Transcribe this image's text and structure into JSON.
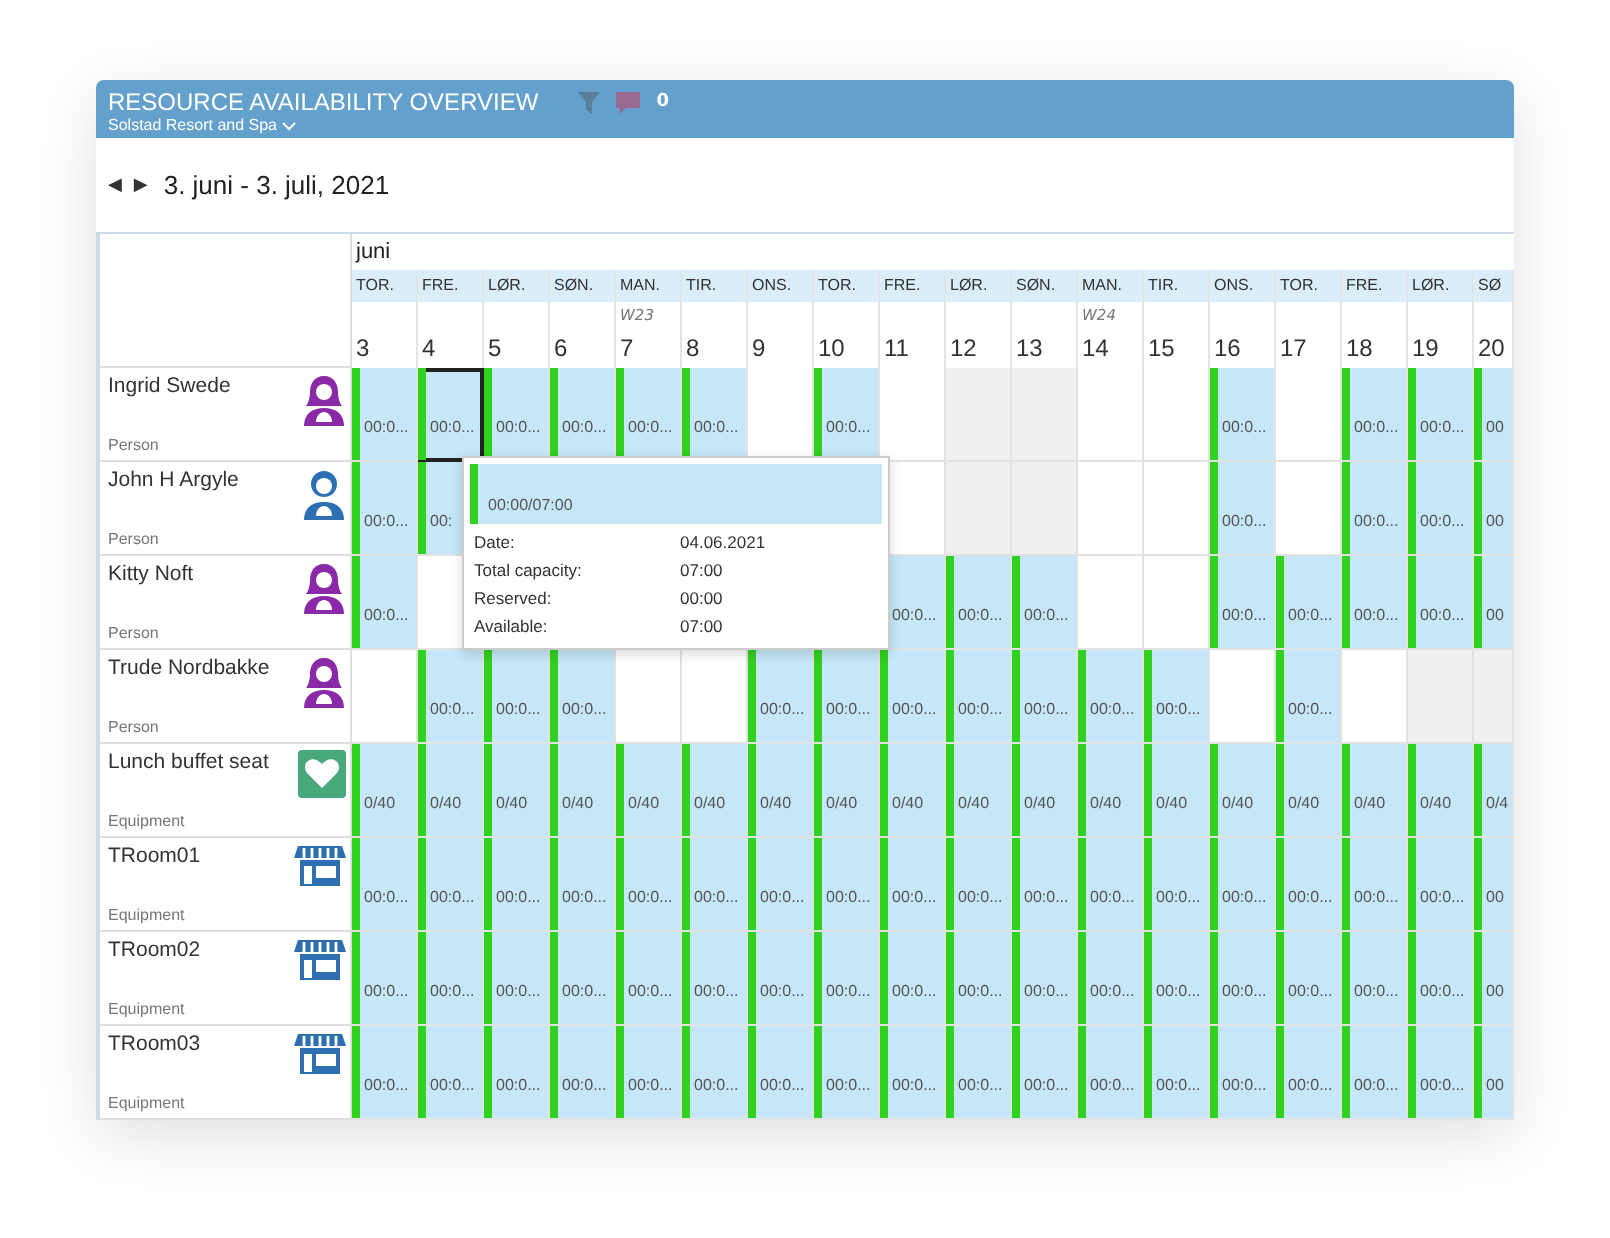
{
  "header": {
    "title": "RESOURCE AVAILABILITY OVERVIEW",
    "comment_count": "0",
    "subtitle": "Solstad Resort and Spa"
  },
  "nav": {
    "prev": "◀",
    "next": "▶",
    "range": "3. juni - 3. juli, 2021"
  },
  "month": "juni",
  "columns": [
    {
      "day_name": "TOR.",
      "day": "3"
    },
    {
      "day_name": "FRE.",
      "day": "4"
    },
    {
      "day_name": "LØR.",
      "day": "5"
    },
    {
      "day_name": "SØN.",
      "day": "6"
    },
    {
      "day_name": "MAN.",
      "day": "7",
      "week": "W23"
    },
    {
      "day_name": "TIR.",
      "day": "8"
    },
    {
      "day_name": "ONS.",
      "day": "9"
    },
    {
      "day_name": "TOR.",
      "day": "10"
    },
    {
      "day_name": "FRE.",
      "day": "11"
    },
    {
      "day_name": "LØR.",
      "day": "12"
    },
    {
      "day_name": "SØN.",
      "day": "13"
    },
    {
      "day_name": "MAN.",
      "day": "14",
      "week": "W24"
    },
    {
      "day_name": "TIR.",
      "day": "15"
    },
    {
      "day_name": "ONS.",
      "day": "16"
    },
    {
      "day_name": "TOR.",
      "day": "17"
    },
    {
      "day_name": "FRE.",
      "day": "18"
    },
    {
      "day_name": "LØR.",
      "day": "19"
    },
    {
      "day_name": "SØ",
      "day": "20"
    }
  ],
  "resources": [
    {
      "name": "Ingrid Swede",
      "type": "Person",
      "kind": "woman",
      "cells": [
        {
          "kind": "booked",
          "text": "00:0...",
          "selected": false
        },
        {
          "kind": "booked",
          "text": "00:0...",
          "selected": true
        },
        {
          "kind": "booked",
          "text": "00:0...",
          "selected": false
        },
        {
          "kind": "booked",
          "text": "00:0...",
          "selected": false
        },
        {
          "kind": "booked",
          "text": "00:0...",
          "selected": false
        },
        {
          "kind": "booked",
          "text": "00:0...",
          "selected": false
        },
        {
          "kind": "free",
          "selected": false
        },
        {
          "kind": "booked",
          "text": "00:0...",
          "selected": false
        },
        {
          "kind": "free",
          "selected": false
        },
        {
          "kind": "closed",
          "selected": false
        },
        {
          "kind": "closed",
          "selected": false
        },
        {
          "kind": "free",
          "selected": false
        },
        {
          "kind": "free",
          "selected": false
        },
        {
          "kind": "booked",
          "text": "00:0...",
          "selected": false
        },
        {
          "kind": "free",
          "selected": false
        },
        {
          "kind": "booked",
          "text": "00:0...",
          "selected": false
        },
        {
          "kind": "booked",
          "text": "00:0...",
          "selected": false
        },
        {
          "kind": "booked",
          "text": "00",
          "selected": false
        }
      ]
    },
    {
      "name": "John H Argyle",
      "type": "Person",
      "kind": "man",
      "cells": [
        {
          "kind": "booked",
          "text": "00:0...",
          "selected": false
        },
        {
          "kind": "booked",
          "text": "00:",
          "selected": false
        },
        {
          "kind": "covered"
        },
        {
          "kind": "covered"
        },
        {
          "kind": "covered"
        },
        {
          "kind": "covered"
        },
        {
          "kind": "covered"
        },
        {
          "kind": "covered"
        },
        {
          "kind": "free",
          "selected": false
        },
        {
          "kind": "closed",
          "selected": false
        },
        {
          "kind": "closed",
          "selected": false
        },
        {
          "kind": "free",
          "selected": false
        },
        {
          "kind": "free",
          "selected": false
        },
        {
          "kind": "booked",
          "text": "00:0...",
          "selected": false
        },
        {
          "kind": "free",
          "selected": false
        },
        {
          "kind": "booked",
          "text": "00:0...",
          "selected": false
        },
        {
          "kind": "booked",
          "text": "00:0...",
          "selected": false
        },
        {
          "kind": "booked",
          "text": "00",
          "selected": false
        }
      ]
    },
    {
      "name": "Kitty Noft",
      "type": "Person",
      "kind": "woman",
      "cells": [
        {
          "kind": "booked",
          "text": "00:0...",
          "selected": false
        },
        {
          "kind": "free",
          "selected": false
        },
        {
          "kind": "covered"
        },
        {
          "kind": "covered"
        },
        {
          "kind": "covered"
        },
        {
          "kind": "covered"
        },
        {
          "kind": "covered"
        },
        {
          "kind": "covered"
        },
        {
          "kind": "booked",
          "text": "00:0...",
          "selected": false
        },
        {
          "kind": "booked",
          "text": "00:0...",
          "selected": false
        },
        {
          "kind": "booked",
          "text": "00:0...",
          "selected": false
        },
        {
          "kind": "free",
          "selected": false
        },
        {
          "kind": "free",
          "selected": false
        },
        {
          "kind": "booked",
          "text": "00:0...",
          "selected": false
        },
        {
          "kind": "booked",
          "text": "00:0...",
          "selected": false
        },
        {
          "kind": "booked",
          "text": "00:0...",
          "selected": false
        },
        {
          "kind": "booked",
          "text": "00:0...",
          "selected": false
        },
        {
          "kind": "booked",
          "text": "00",
          "selected": false
        }
      ]
    },
    {
      "name": "Trude Nordbakke",
      "type": "Person",
      "kind": "woman",
      "cells": [
        {
          "kind": "free",
          "selected": false
        },
        {
          "kind": "booked",
          "text": "00:0...",
          "selected": false
        },
        {
          "kind": "booked",
          "text": "00:0...",
          "selected": false
        },
        {
          "kind": "booked",
          "text": "00:0...",
          "selected": false
        },
        {
          "kind": "free",
          "selected": false
        },
        {
          "kind": "free",
          "selected": false
        },
        {
          "kind": "booked",
          "text": "00:0...",
          "selected": false
        },
        {
          "kind": "booked",
          "text": "00:0...",
          "selected": false
        },
        {
          "kind": "booked",
          "text": "00:0...",
          "selected": false
        },
        {
          "kind": "booked",
          "text": "00:0...",
          "selected": false
        },
        {
          "kind": "booked",
          "text": "00:0...",
          "selected": false
        },
        {
          "kind": "booked",
          "text": "00:0...",
          "selected": false
        },
        {
          "kind": "booked",
          "text": "00:0...",
          "selected": false
        },
        {
          "kind": "free",
          "selected": false
        },
        {
          "kind": "booked",
          "text": "00:0...",
          "selected": false
        },
        {
          "kind": "free",
          "selected": false
        },
        {
          "kind": "closed",
          "selected": false
        },
        {
          "kind": "closed",
          "selected": false
        }
      ]
    },
    {
      "name": "Lunch buffet seat",
      "type": "Equipment",
      "kind": "heart",
      "cells": [
        {
          "kind": "booked",
          "text": "0/40",
          "selected": false
        },
        {
          "kind": "booked",
          "text": "0/40",
          "selected": false
        },
        {
          "kind": "booked",
          "text": "0/40",
          "selected": false
        },
        {
          "kind": "booked",
          "text": "0/40",
          "selected": false
        },
        {
          "kind": "booked",
          "text": "0/40",
          "selected": false
        },
        {
          "kind": "booked",
          "text": "0/40",
          "selected": false
        },
        {
          "kind": "booked",
          "text": "0/40",
          "selected": false
        },
        {
          "kind": "booked",
          "text": "0/40",
          "selected": false
        },
        {
          "kind": "booked",
          "text": "0/40",
          "selected": false
        },
        {
          "kind": "booked",
          "text": "0/40",
          "selected": false
        },
        {
          "kind": "booked",
          "text": "0/40",
          "selected": false
        },
        {
          "kind": "booked",
          "text": "0/40",
          "selected": false
        },
        {
          "kind": "booked",
          "text": "0/40",
          "selected": false
        },
        {
          "kind": "booked",
          "text": "0/40",
          "selected": false
        },
        {
          "kind": "booked",
          "text": "0/40",
          "selected": false
        },
        {
          "kind": "booked",
          "text": "0/40",
          "selected": false
        },
        {
          "kind": "booked",
          "text": "0/40",
          "selected": false
        },
        {
          "kind": "booked",
          "text": "0/4",
          "selected": false
        }
      ]
    },
    {
      "name": "TRoom01",
      "type": "Equipment",
      "kind": "store",
      "cells": [
        {
          "kind": "booked",
          "text": "00:0...",
          "selected": false
        },
        {
          "kind": "booked",
          "text": "00:0...",
          "selected": false
        },
        {
          "kind": "booked",
          "text": "00:0...",
          "selected": false
        },
        {
          "kind": "booked",
          "text": "00:0...",
          "selected": false
        },
        {
          "kind": "booked",
          "text": "00:0...",
          "selected": false
        },
        {
          "kind": "booked",
          "text": "00:0...",
          "selected": false
        },
        {
          "kind": "booked",
          "text": "00:0...",
          "selected": false
        },
        {
          "kind": "booked",
          "text": "00:0...",
          "selected": false
        },
        {
          "kind": "booked",
          "text": "00:0...",
          "selected": false
        },
        {
          "kind": "booked",
          "text": "00:0...",
          "selected": false
        },
        {
          "kind": "booked",
          "text": "00:0...",
          "selected": false
        },
        {
          "kind": "booked",
          "text": "00:0...",
          "selected": false
        },
        {
          "kind": "booked",
          "text": "00:0...",
          "selected": false
        },
        {
          "kind": "booked",
          "text": "00:0...",
          "selected": false
        },
        {
          "kind": "booked",
          "text": "00:0...",
          "selected": false
        },
        {
          "kind": "booked",
          "text": "00:0...",
          "selected": false
        },
        {
          "kind": "booked",
          "text": "00:0...",
          "selected": false
        },
        {
          "kind": "booked",
          "text": "00",
          "selected": false
        }
      ]
    },
    {
      "name": "TRoom02",
      "type": "Equipment",
      "kind": "store",
      "cells": [
        {
          "kind": "booked",
          "text": "00:0...",
          "selected": false
        },
        {
          "kind": "booked",
          "text": "00:0...",
          "selected": false
        },
        {
          "kind": "booked",
          "text": "00:0...",
          "selected": false
        },
        {
          "kind": "booked",
          "text": "00:0...",
          "selected": false
        },
        {
          "kind": "booked",
          "text": "00:0...",
          "selected": false
        },
        {
          "kind": "booked",
          "text": "00:0...",
          "selected": false
        },
        {
          "kind": "booked",
          "text": "00:0...",
          "selected": false
        },
        {
          "kind": "booked",
          "text": "00:0...",
          "selected": false
        },
        {
          "kind": "booked",
          "text": "00:0...",
          "selected": false
        },
        {
          "kind": "booked",
          "text": "00:0...",
          "selected": false
        },
        {
          "kind": "booked",
          "text": "00:0...",
          "selected": false
        },
        {
          "kind": "booked",
          "text": "00:0...",
          "selected": false
        },
        {
          "kind": "booked",
          "text": "00:0...",
          "selected": false
        },
        {
          "kind": "booked",
          "text": "00:0...",
          "selected": false
        },
        {
          "kind": "booked",
          "text": "00:0...",
          "selected": false
        },
        {
          "kind": "booked",
          "text": "00:0...",
          "selected": false
        },
        {
          "kind": "booked",
          "text": "00:0...",
          "selected": false
        },
        {
          "kind": "booked",
          "text": "00",
          "selected": false
        }
      ]
    },
    {
      "name": "TRoom03",
      "type": "Equipment",
      "kind": "store",
      "cells": [
        {
          "kind": "booked",
          "text": "00:0...",
          "selected": false
        },
        {
          "kind": "booked",
          "text": "00:0...",
          "selected": false
        },
        {
          "kind": "booked",
          "text": "00:0...",
          "selected": false
        },
        {
          "kind": "booked",
          "text": "00:0...",
          "selected": false
        },
        {
          "kind": "booked",
          "text": "00:0...",
          "selected": false
        },
        {
          "kind": "booked",
          "text": "00:0...",
          "selected": false
        },
        {
          "kind": "booked",
          "text": "00:0...",
          "selected": false
        },
        {
          "kind": "booked",
          "text": "00:0...",
          "selected": false
        },
        {
          "kind": "booked",
          "text": "00:0...",
          "selected": false
        },
        {
          "kind": "booked",
          "text": "00:0...",
          "selected": false
        },
        {
          "kind": "booked",
          "text": "00:0...",
          "selected": false
        },
        {
          "kind": "booked",
          "text": "00:0...",
          "selected": false
        },
        {
          "kind": "booked",
          "text": "00:0...",
          "selected": false
        },
        {
          "kind": "booked",
          "text": "00:0...",
          "selected": false
        },
        {
          "kind": "booked",
          "text": "00:0...",
          "selected": false
        },
        {
          "kind": "booked",
          "text": "00:0...",
          "selected": false
        },
        {
          "kind": "booked",
          "text": "00:0...",
          "selected": false
        },
        {
          "kind": "booked",
          "text": "00",
          "selected": false
        }
      ]
    }
  ],
  "tooltip": {
    "bar_text": "00:00/07:00",
    "details": [
      {
        "label": "Date:",
        "value": "04.06.2021"
      },
      {
        "label": "Total capacity:",
        "value": "07:00"
      },
      {
        "label": "Reserved:",
        "value": "00:00"
      },
      {
        "label": "Available:",
        "value": "07:00"
      }
    ]
  }
}
